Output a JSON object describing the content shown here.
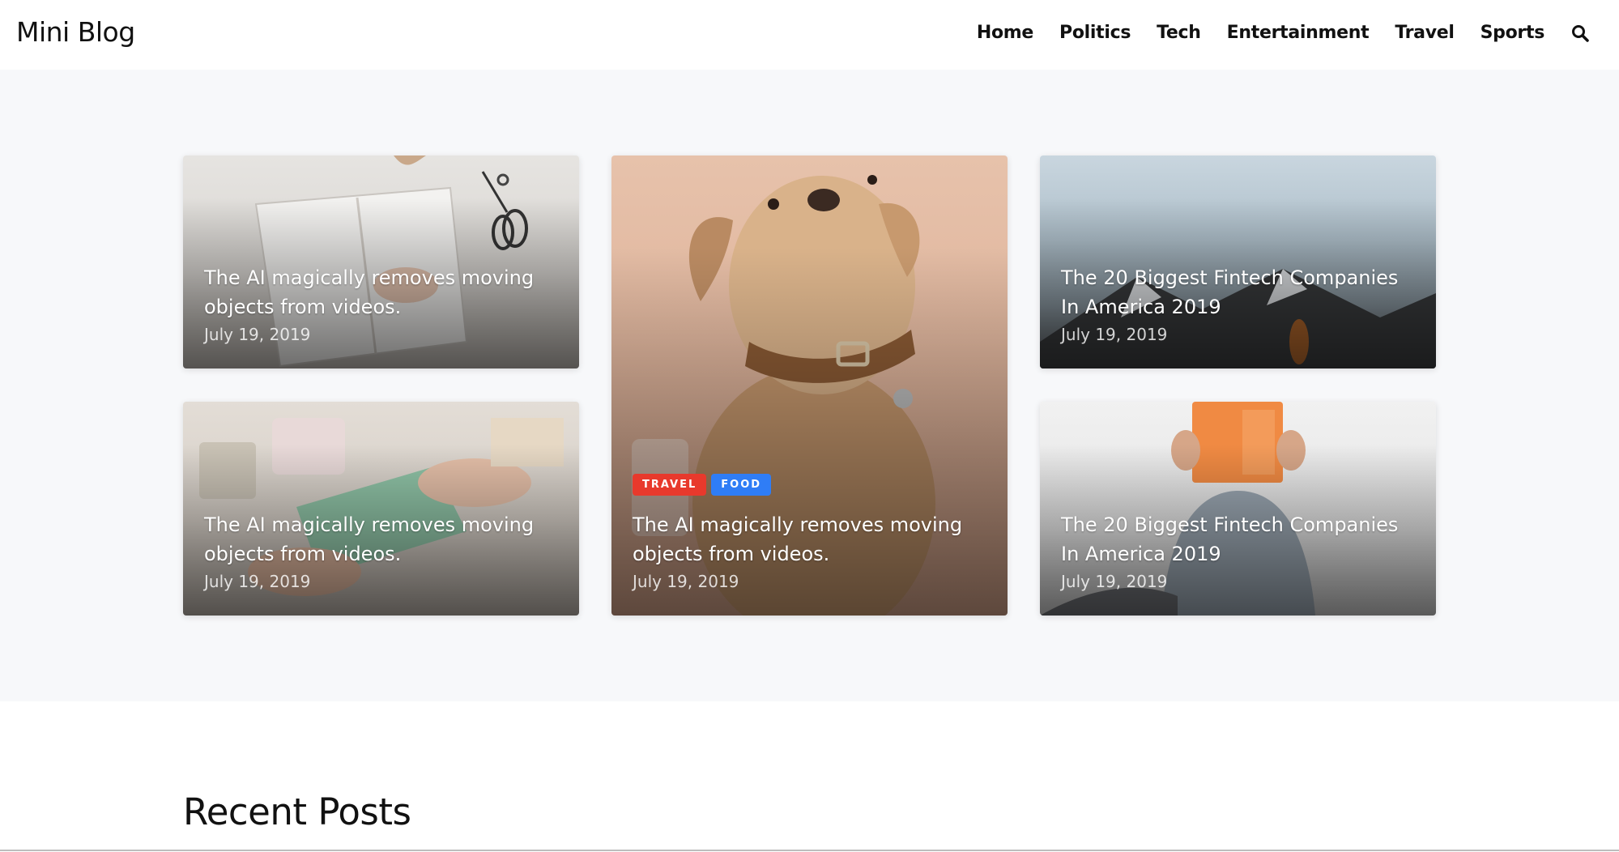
{
  "site": {
    "logo": "Mini Blog"
  },
  "nav": {
    "items": [
      "Home",
      "Politics",
      "Tech",
      "Entertainment",
      "Travel",
      "Sports"
    ]
  },
  "colors": {
    "tag_travel": "#e8392c",
    "tag_food": "#2f7df6",
    "hero_bg": "#f7f8fa"
  },
  "featured": [
    {
      "title": "The AI magically removes moving objects from videos.",
      "date": "July 19, 2019",
      "image": "notebook-with-scissors"
    },
    {
      "title": "The AI magically removes moving objects from videos.",
      "date": "July 19, 2019",
      "image": "dog-with-collar",
      "tags": [
        "TRAVEL",
        "FOOD"
      ]
    },
    {
      "title": "The 20 Biggest Fintech Companies In America 2019",
      "date": "July 19, 2019",
      "image": "misty-mountain"
    },
    {
      "title": "The AI magically removes moving objects from videos.",
      "date": "July 19, 2019",
      "image": "hands-with-soap"
    },
    {
      "title": "The 20 Biggest Fintech Companies In America 2019",
      "date": "July 19, 2019",
      "image": "man-reading-book"
    }
  ],
  "recent": {
    "heading": "Recent Posts"
  }
}
